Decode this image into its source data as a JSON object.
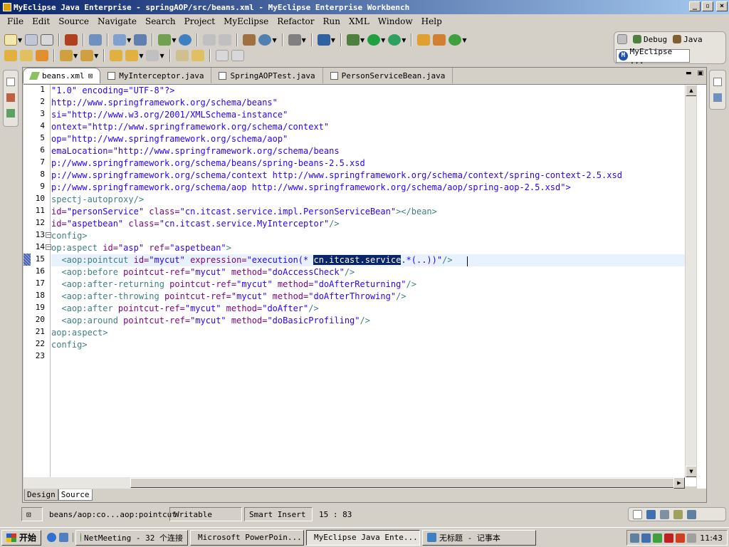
{
  "window": {
    "title": "MyEclipse Java Enterprise - springAOP/src/beans.xml - MyEclipse Enterprise Workbench",
    "buttons": [
      "_",
      "▫",
      "×"
    ]
  },
  "menu": [
    "File",
    "Edit",
    "Source",
    "Navigate",
    "Search",
    "Project",
    "MyEclipse",
    "Refactor",
    "Run",
    "XML",
    "Window",
    "Help"
  ],
  "perspectives": {
    "debug": "Debug",
    "java": "Java",
    "myeclipse": "MyEclipse ..."
  },
  "tabs": [
    {
      "label": "beans.xml",
      "active": true,
      "closable": true
    },
    {
      "label": "MyInterceptor.java",
      "active": false
    },
    {
      "label": "SpringAOPTest.java",
      "active": false
    },
    {
      "label": "PersonServiceBean.java",
      "active": false
    }
  ],
  "editor": {
    "line_numbers": [
      "1",
      "2",
      "3",
      "4",
      "5",
      "6",
      "7",
      "8",
      "9",
      "10",
      "11",
      "12",
      "13",
      "14",
      "15",
      "16",
      "17",
      "18",
      "19",
      "20",
      "21",
      "22",
      "23"
    ],
    "selected_text": "cn.itcast.service",
    "lines": {
      "l1": "\"1.0\" encoding=\"UTF-8\"?>",
      "l2": "http://www.springframework.org/schema/beans\"",
      "l3": "si=\"http://www.w3.org/2001/XMLSchema-instance\"",
      "l4": "ontext=\"http://www.springframework.org/schema/context\"",
      "l5": "op=\"http://www.springframework.org/schema/aop\"",
      "l6": "emaLocation=\"http://www.springframework.org/schema/beans",
      "l7": "p://www.springframework.org/schema/beans/spring-beans-2.5.xsd",
      "l8": "p://www.springframework.org/schema/context http://www.springframework.org/schema/context/spring-context-2.5.xsd",
      "l9": "p://www.springframework.org/schema/aop http://www.springframework.org/schema/aop/spring-aop-2.5.xsd\">",
      "l10": "spectj-autoproxy/>",
      "l11a": "id=",
      "l11b": "\"personService\"",
      "l11c": " class=",
      "l11d": "\"cn.itcast.service.impl.PersonServiceBean\"",
      "l11e": "></bean>",
      "l12a": "id=",
      "l12b": "\"aspetbean\"",
      "l12c": " class=",
      "l12d": "\"cn.itcast.service.MyInterceptor\"",
      "l12e": "/>",
      "l13": "config>",
      "l14a": "op:aspect",
      "l14b": " id=",
      "l14c": "\"asp\"",
      "l14d": " ref=",
      "l14e": "\"aspetbean\"",
      "l14f": ">",
      "l15a": "  <aop:pointcut",
      "l15b": " id=",
      "l15c": "\"mycut\"",
      "l15d": " expression=",
      "l15e": "\"execution(* ",
      "l15g": ".*(..))\"",
      "l15h": "/>",
      "l16a": "  <aop:before",
      "l16b": " pointcut-ref=",
      "l16c": "\"mycut\"",
      "l16d": " method=",
      "l16e": "\"doAccessCheck\"",
      "l16f": "/>",
      "l17a": "  <aop:after-returning",
      "l17b": " pointcut-ref=",
      "l17c": "\"mycut\"",
      "l17d": " method=",
      "l17e": "\"doAfterReturning\"",
      "l17f": "/>",
      "l18a": "  <aop:after-throwing",
      "l18b": " pointcut-ref=",
      "l18c": "\"mycut\"",
      "l18d": " method=",
      "l18e": "\"doAfterThrowing\"",
      "l18f": "/>",
      "l19a": "  <aop:after",
      "l19b": " pointcut-ref=",
      "l19c": "\"mycut\"",
      "l19d": " method=",
      "l19e": "\"doAfter\"",
      "l19f": "/>",
      "l20a": "  <aop:around",
      "l20b": " pointcut-ref=",
      "l20c": "\"mycut\"",
      "l20d": " method=",
      "l20e": "\"doBasicProfiling\"",
      "l20f": "/>",
      "l21": "aop:aspect>",
      "l22": "config>"
    }
  },
  "bottom_tabs": {
    "design": "Design",
    "source": "Source"
  },
  "status": {
    "path": "beans/aop:co...aop:pointcut",
    "writable": "Writable",
    "insert_mode": "Smart Insert",
    "position": "15 : 83"
  },
  "taskbar": {
    "start": "开始",
    "tasks": [
      {
        "label": "NetMeeting - 32 个连接",
        "active": false
      },
      {
        "label": "Microsoft PowerPoin...",
        "active": false
      },
      {
        "label": "MyEclipse Java Ente...",
        "active": true
      },
      {
        "label": "无标题 - 记事本",
        "active": false
      }
    ],
    "clock": "11:43"
  },
  "colors": {
    "tag": "#3f7f7f",
    "attribute": "#7f007f",
    "value": "#2a00ff",
    "selection": "#0a246a",
    "title_gradient_start": "#0a246a"
  }
}
